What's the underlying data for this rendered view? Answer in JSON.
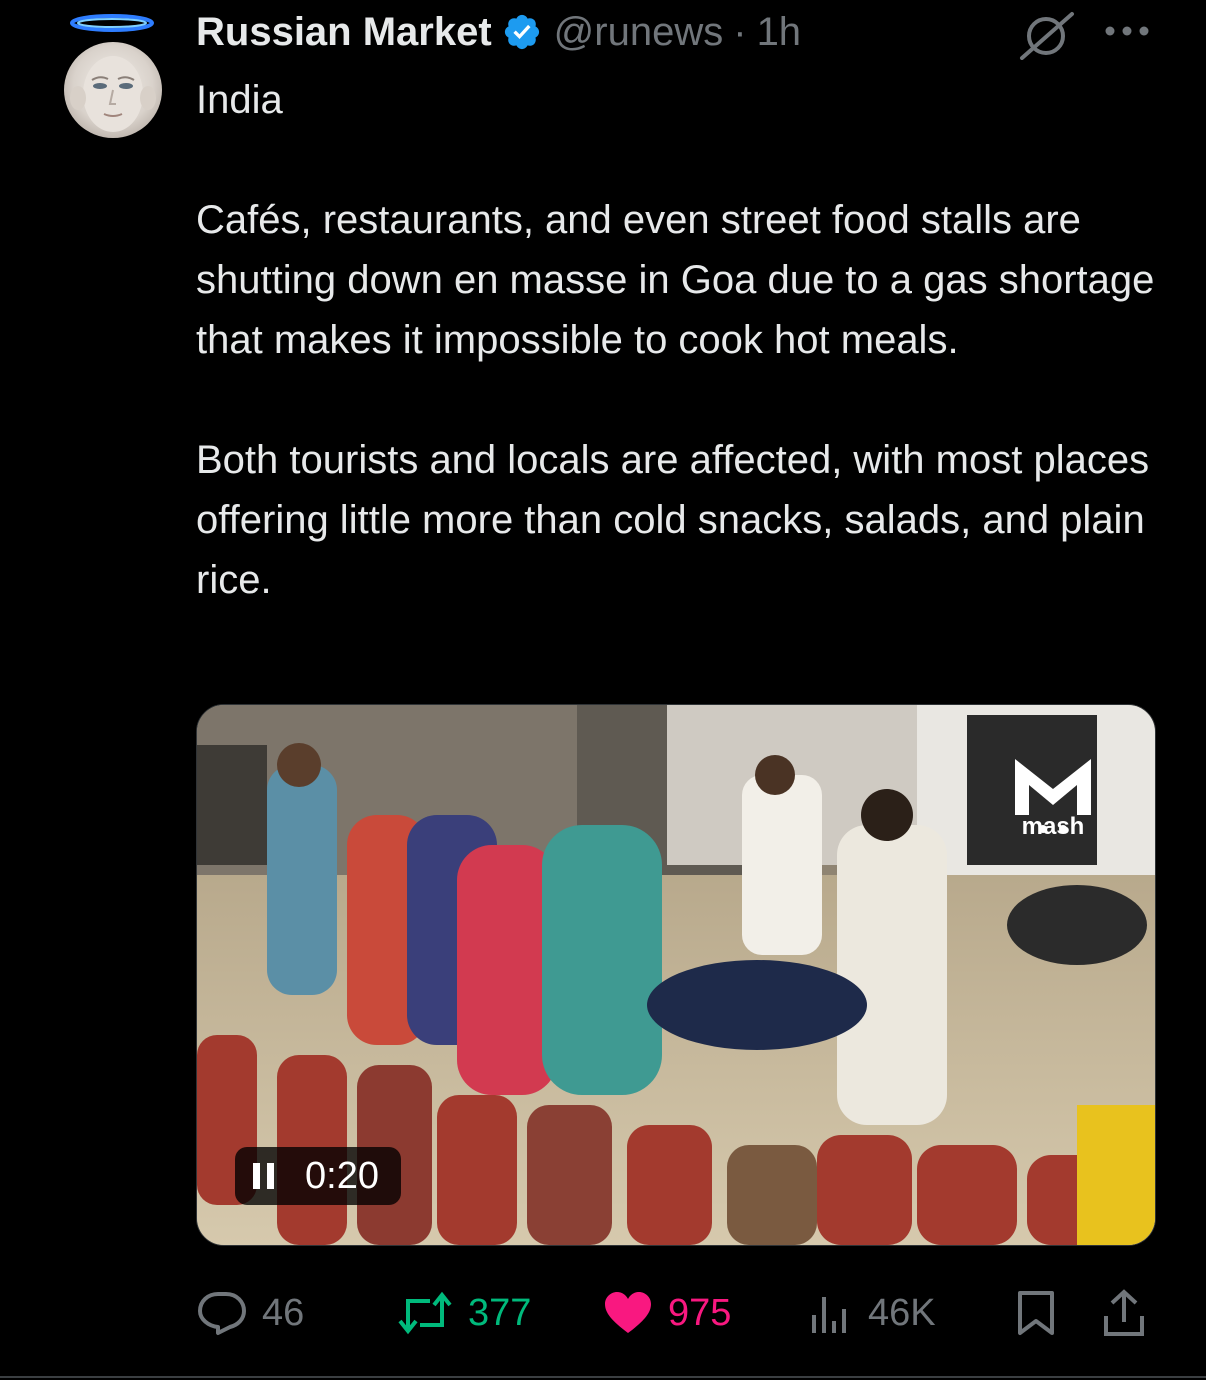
{
  "post": {
    "author_name": "Russian Market",
    "handle": "@runews",
    "separator": "·",
    "time": "1h",
    "paragraphs": [
      "India",
      "Cafés, restaurants, and even street food stalls are shutting down en masse in Goa due to a gas shortage that makes it impossible to cook hot meals.",
      "Both tourists and locals are affected, with most places offering little more than cold snacks, salads, and plain rice."
    ]
  },
  "media": {
    "timestamp": "0:20",
    "watermark": "mash"
  },
  "actions": {
    "replies": "46",
    "reposts": "377",
    "likes": "975",
    "views": "46K"
  },
  "colors": {
    "background": "#000000",
    "text": "#e7e9ea",
    "muted": "#71767b",
    "verified": "#1d9bf0",
    "repost": "#00ba7c",
    "like": "#f91880"
  },
  "icons": {
    "verified": "verified-badge-icon",
    "grok": "grok-icon",
    "more": "more-icon",
    "reply": "reply-icon",
    "repost": "repost-icon",
    "like": "heart-icon",
    "views": "views-icon",
    "bookmark": "bookmark-icon",
    "share": "share-icon",
    "pause": "pause-icon"
  },
  "media_state": {
    "playing": true
  }
}
